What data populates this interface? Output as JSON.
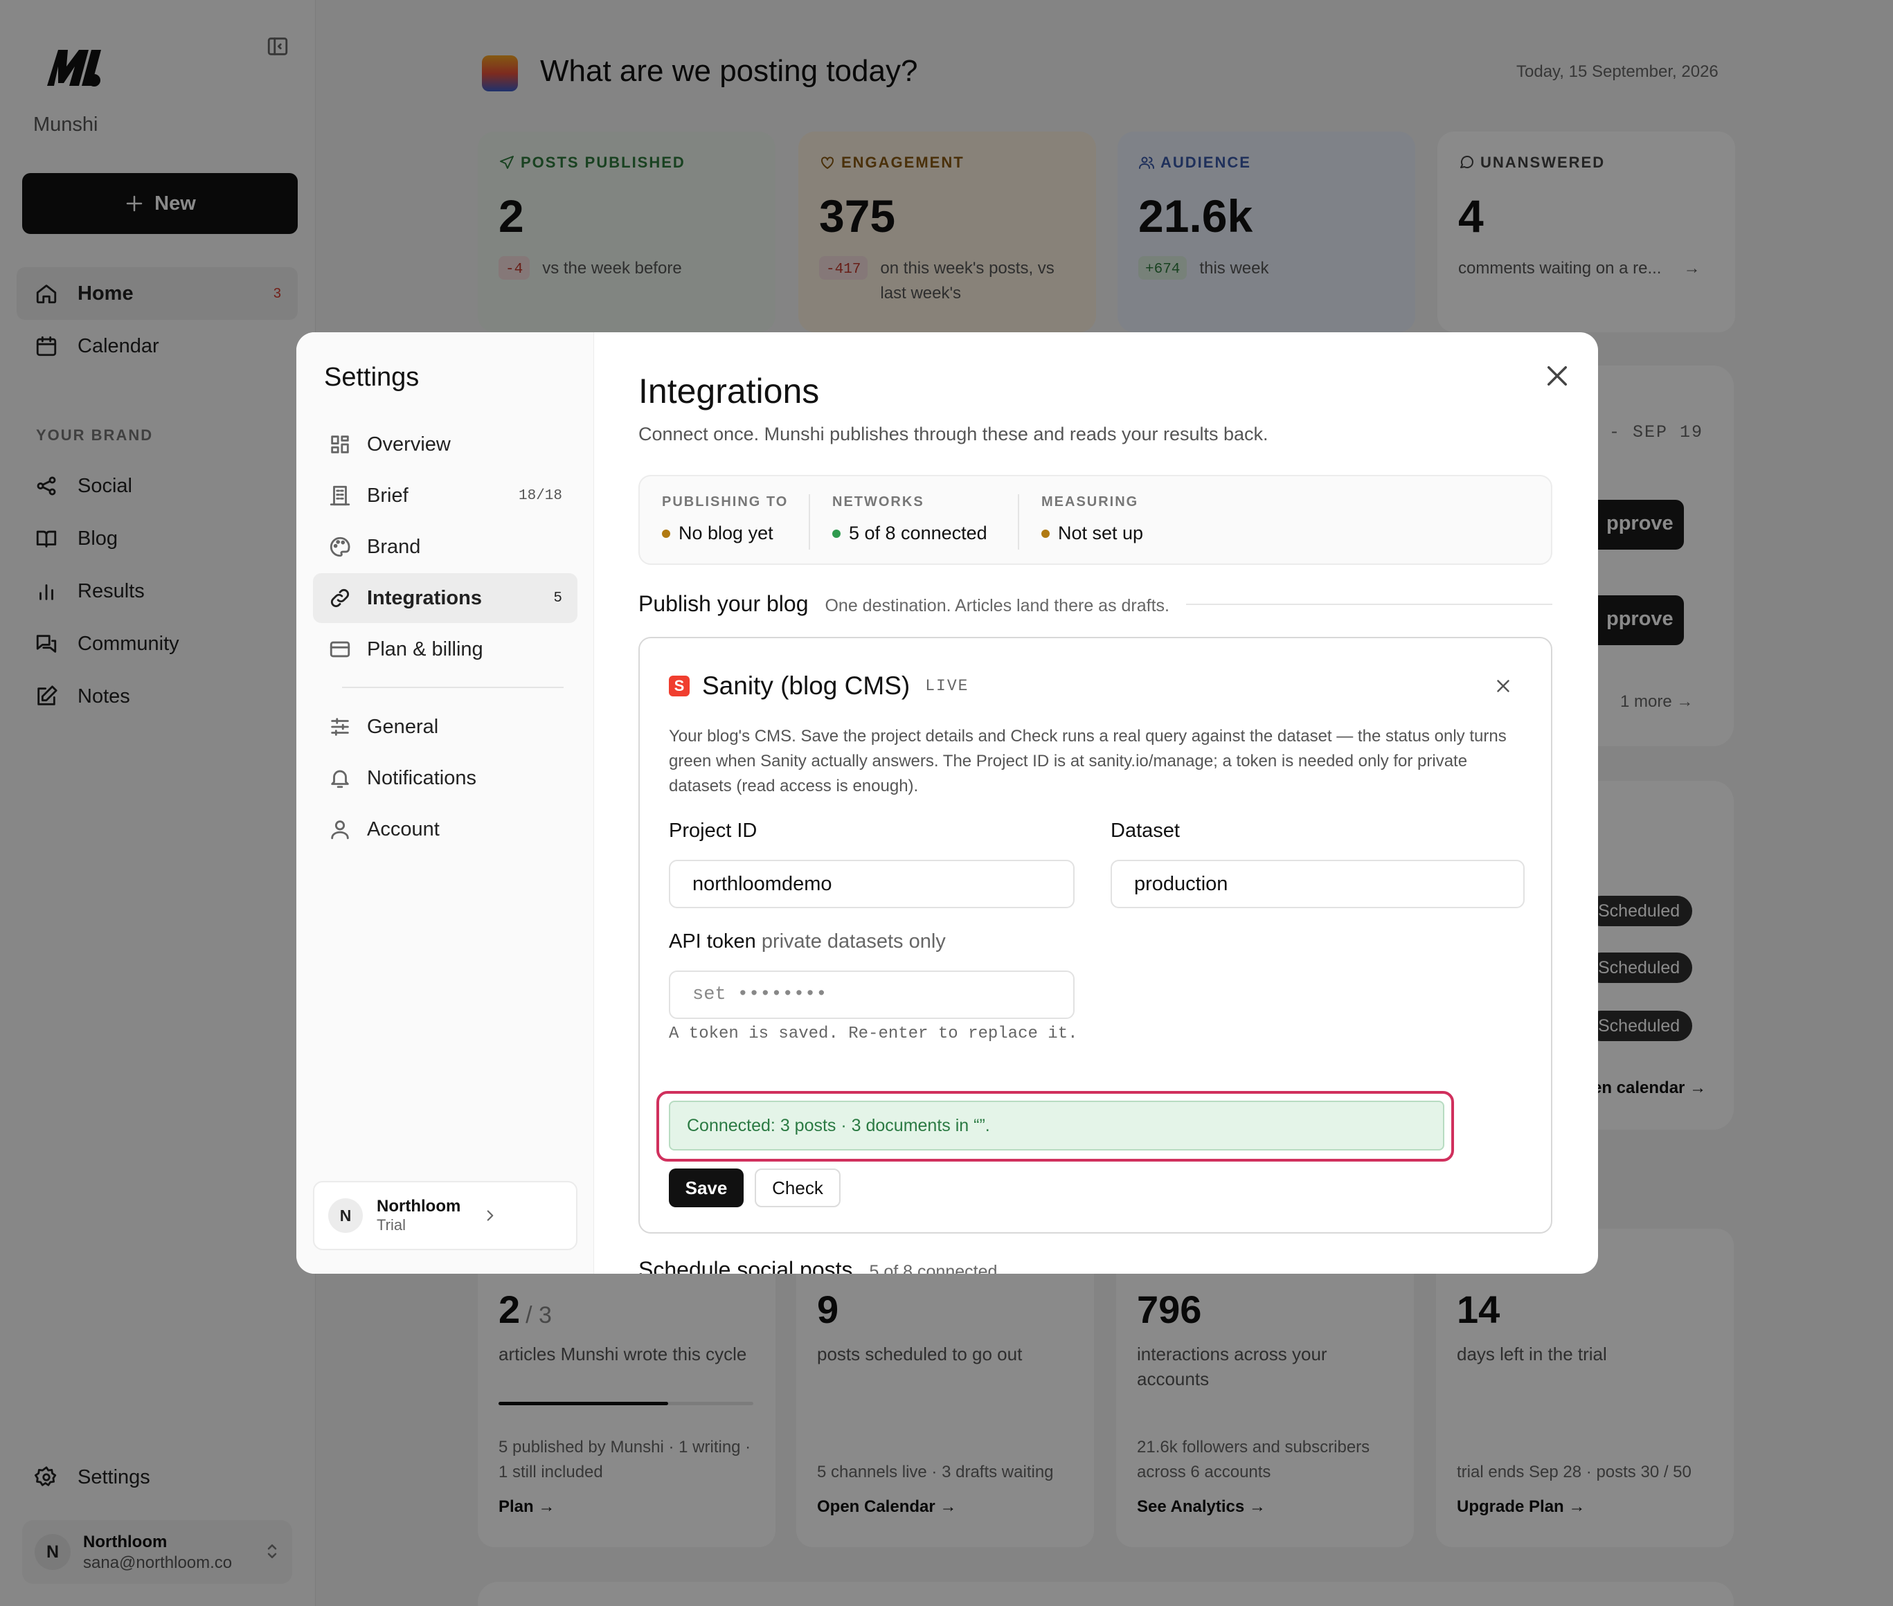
{
  "app": {
    "name": "Munshi"
  },
  "sidebar": {
    "new_label": "New",
    "nav": [
      {
        "label": "Home",
        "badge": "3"
      },
      {
        "label": "Calendar"
      }
    ],
    "section_label": "YOUR BRAND",
    "brand_nav": [
      {
        "label": "Social"
      },
      {
        "label": "Blog"
      },
      {
        "label": "Results"
      },
      {
        "label": "Community"
      },
      {
        "label": "Notes"
      }
    ],
    "settings_label": "Settings",
    "user": {
      "initial": "N",
      "name": "Northloom",
      "email": "sana@northloom.co"
    }
  },
  "main": {
    "greeting": "What are we posting today?",
    "date": "Today, 15 September, 2026",
    "stats": [
      {
        "label": "POSTS PUBLISHED",
        "value": "2",
        "delta": "-4",
        "delta_text": "vs the week before",
        "color": "#2f7a3e"
      },
      {
        "label": "ENGAGEMENT",
        "value": "375",
        "delta": "-417",
        "delta_text": "on this week's posts, vs last week's",
        "color": "#8a5a14"
      },
      {
        "label": "AUDIENCE",
        "value": "21.6k",
        "delta": "+674",
        "delta_text": "this week",
        "color": "#3a5aa8"
      },
      {
        "label": "UNANSWERED",
        "value": "4",
        "delta_text": "comments waiting on a re...",
        "color": "#444"
      }
    ],
    "range_text": "- SEP 19",
    "approve_label": "pprove",
    "more_label": "1 more",
    "scheduled_label": "Scheduled",
    "calendar_link": "en calendar →",
    "bottom_cards": [
      {
        "value": "2",
        "value_suffix": "/ 3",
        "desc": "articles Munshi wrote this cycle",
        "foot": "5 published by Munshi · 1 writing · 1 still included",
        "link": "Plan →",
        "progress": 0.667
      },
      {
        "value": "9",
        "desc": "posts scheduled to go out",
        "foot": "5 channels live · 3 drafts waiting",
        "link": "Open Calendar →"
      },
      {
        "value": "796",
        "desc": "interactions across your accounts",
        "foot": "21.6k followers and subscribers across 6 accounts",
        "link": "See Analytics →"
      },
      {
        "value": "14",
        "desc": "days left in the trial",
        "foot": "trial ends Sep 28 · posts 30 / 50",
        "link": "Upgrade Plan →"
      }
    ]
  },
  "settings": {
    "title": "Settings",
    "nav": [
      {
        "label": "Overview",
        "icon": "grid-icon"
      },
      {
        "label": "Brief",
        "count": "18/18",
        "icon": "building-icon"
      },
      {
        "label": "Brand",
        "icon": "palette-icon"
      },
      {
        "label": "Integrations",
        "count": "5",
        "icon": "link-icon"
      },
      {
        "label": "Plan & billing",
        "icon": "card-icon"
      }
    ],
    "nav2": [
      {
        "label": "General",
        "icon": "sliders-icon"
      },
      {
        "label": "Notifications",
        "icon": "bell-icon"
      },
      {
        "label": "Account",
        "icon": "user-icon"
      }
    ],
    "org": {
      "initial": "N",
      "name": "Northloom",
      "plan": "Trial"
    }
  },
  "integrations": {
    "title": "Integrations",
    "lead": "Connect once. Munshi publishes through these and reads your results back.",
    "status": [
      {
        "label": "PUBLISHING TO",
        "value": "No blog yet",
        "dot": "#b07a12"
      },
      {
        "label": "NETWORKS",
        "value": "5 of 8 connected",
        "dot": "#2f9a4e"
      },
      {
        "label": "MEASURING",
        "value": "Not set up",
        "dot": "#b07a12"
      }
    ],
    "publish_title": "Publish your blog",
    "publish_hint": "One destination. Articles land there as drafts.",
    "card": {
      "name": "Sanity (blog CMS)",
      "logo_letter": "S",
      "state": "LIVE",
      "desc": "Your blog's CMS. Save the project details and Check runs a real query against the dataset — the status only turns green when Sanity actually answers. The Project ID is at sanity.io/manage; a token is needed only for private datasets (read access is enough).",
      "project_label": "Project ID",
      "project_value": "northloomdemo",
      "dataset_label": "Dataset",
      "dataset_value": "production",
      "token_label": "API token",
      "token_hint": "private datasets only",
      "token_placeholder": "set ••••••••",
      "token_help": "A token is saved. Re-enter to replace it.",
      "status_msg": "Connected: 3 posts · 3 documents in “”.",
      "save_label": "Save",
      "check_label": "Check"
    },
    "social_title": "Schedule social posts",
    "social_hint": "5 of 8 connected"
  }
}
